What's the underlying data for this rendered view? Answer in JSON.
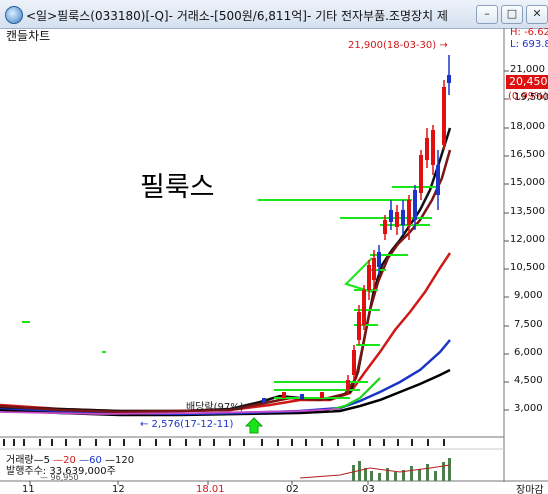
{
  "window": {
    "title": "<일>필룩스(033180)[-Q]- 거래소-[500원/6,811억]- 기타 전자부품.조명장치 제",
    "btn_min": "–",
    "btn_max": "□",
    "btn_close": "✕",
    "icon": "app-globe-icon"
  },
  "chart": {
    "label": "캔들차트",
    "stock_name": "필룩스",
    "high_label": "H: -6.62",
    "low_label": "L: 693.8",
    "max_annotation": "21,900(18-03-30) →",
    "min_annotation": "← 2,576(17-12-11)",
    "dividend_annotation": "배당락(97%)",
    "current_price": "20,450",
    "current_change": "(0,99%)",
    "y_ticks": [
      "21,000",
      "19,500",
      "18,000",
      "16,500",
      "15,000",
      "13,500",
      "12,000",
      "10,500",
      "9,000",
      "7,500",
      "6,000",
      "4,500",
      "3,000"
    ],
    "x_ticks": [
      "11",
      "12",
      "18.01",
      "02",
      "03"
    ]
  },
  "volume": {
    "legend_prefix": "거래량",
    "ma5": "5",
    "ma20": "20",
    "ma60": "60",
    "ma120": "120",
    "shares_label": "발행주수: 33,639,000주",
    "shares_cut": "— 96,950",
    "market_label": "장마감"
  },
  "colors": {
    "up": "#e01010",
    "down": "#1a35c8",
    "ma5": "#111111",
    "ma20": "#d01818",
    "ma60": "#1a35c8",
    "ma120": "#000000",
    "bars": "#19e619",
    "accent": "#e01010"
  }
}
